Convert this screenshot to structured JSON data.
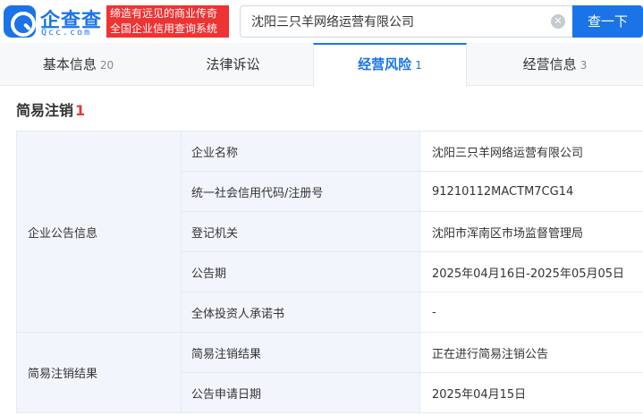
{
  "brand": {
    "logo_title": "企查查",
    "logo_domain": "Qcc.com",
    "slogan_line1": "缔造有远见的商业传奇",
    "slogan_line2": "全国企业信用查询系统"
  },
  "search": {
    "value": "沈阳三只羊网络运营有限公司",
    "button_label": "查一下"
  },
  "tabs": [
    {
      "label": "基本信息",
      "count": "20"
    },
    {
      "label": "法律诉讼",
      "count": ""
    },
    {
      "label": "经营风险",
      "count": "1"
    },
    {
      "label": "经营信息",
      "count": "3"
    }
  ],
  "section": {
    "title": "简易注销",
    "count": "1"
  },
  "table": {
    "groups": [
      {
        "name": "企业公告信息",
        "rows": [
          {
            "label": "企业名称",
            "value": "沈阳三只羊网络运营有限公司"
          },
          {
            "label": "统一社会信用代码/注册号",
            "value": "91210112MACTM7CG14"
          },
          {
            "label": "登记机关",
            "value": "沈阳市浑南区市场监督管理局"
          },
          {
            "label": "公告期",
            "value": "2025年04月16日-2025年05月05日"
          },
          {
            "label": "全体投资人承诺书",
            "value": "-"
          }
        ]
      },
      {
        "name": "简易注销结果",
        "rows": [
          {
            "label": "简易注销结果",
            "value": "正在进行简易注销公告"
          },
          {
            "label": "公告申请日期",
            "value": "2025年04月15日"
          }
        ]
      }
    ]
  }
}
